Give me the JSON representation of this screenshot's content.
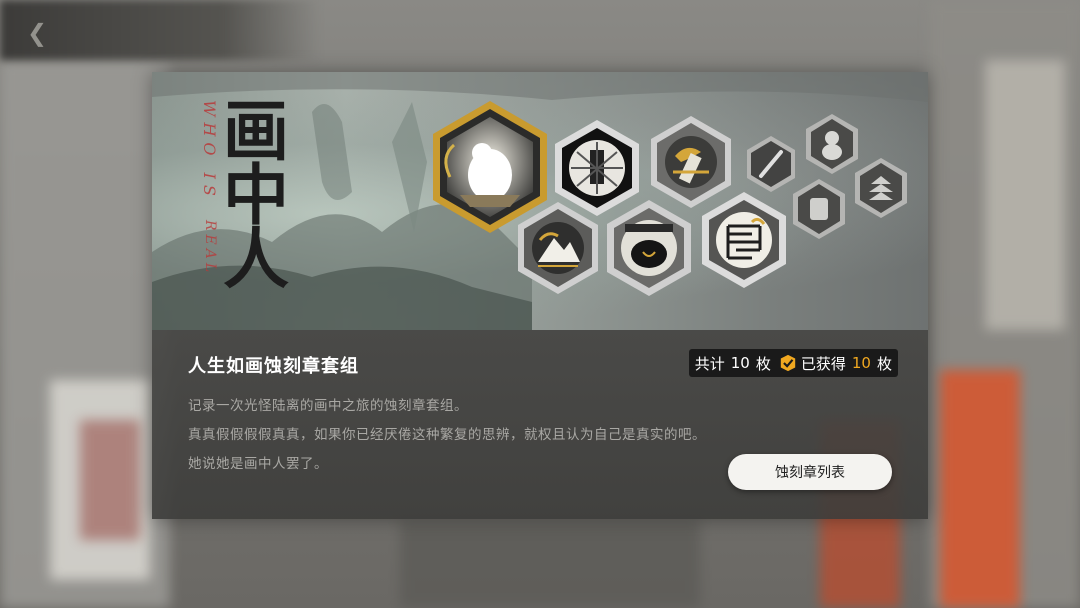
{
  "background": {
    "back_icon": "back-arrow-icon"
  },
  "banner": {
    "art_title": "画中人",
    "art_subtitle_top": "WHO IS",
    "art_subtitle_bottom": "REAL",
    "badges": [
      {
        "name": "badge-large-white-beast",
        "icon": "white-beast-icon",
        "tier": "gold"
      },
      {
        "name": "badge-pillar",
        "icon": "pillar-icon",
        "tier": "silver"
      },
      {
        "name": "badge-scroll-gold",
        "icon": "scroll-icon",
        "tier": "silver"
      },
      {
        "name": "badge-brush",
        "icon": "brush-icon",
        "tier": "silver"
      },
      {
        "name": "badge-gourd",
        "icon": "gourd-icon",
        "tier": "silver"
      },
      {
        "name": "badge-mountain",
        "icon": "mountain-icon",
        "tier": "silver"
      },
      {
        "name": "badge-black-beast",
        "icon": "black-beast-icon",
        "tier": "silver"
      },
      {
        "name": "badge-maze-seal",
        "icon": "maze-seal-icon",
        "tier": "silver"
      },
      {
        "name": "badge-small-seal",
        "icon": "seal-icon",
        "tier": "silver"
      },
      {
        "name": "badge-small-stack",
        "icon": "stack-icon",
        "tier": "silver"
      }
    ]
  },
  "info": {
    "set_title": "人生如画蚀刻章套组",
    "total_label": "共计",
    "total_count": "10",
    "unit": "枚",
    "obtained_label": "已获得",
    "obtained_count": "10",
    "obtained_unit": "枚",
    "description_lines": [
      "记录一次光怪陆离的画中之旅的蚀刻章套组。",
      "真真假假假假真真，如果你已经厌倦这种繁复的思辨，就权且认为自己是真实的吧。",
      "她说她是画中人罢了。"
    ],
    "list_button": "蚀刻章列表"
  },
  "colors": {
    "accent": "#f0a820",
    "gold_frame": "#d4a63a",
    "silver_frame": "#c9c9c9"
  }
}
